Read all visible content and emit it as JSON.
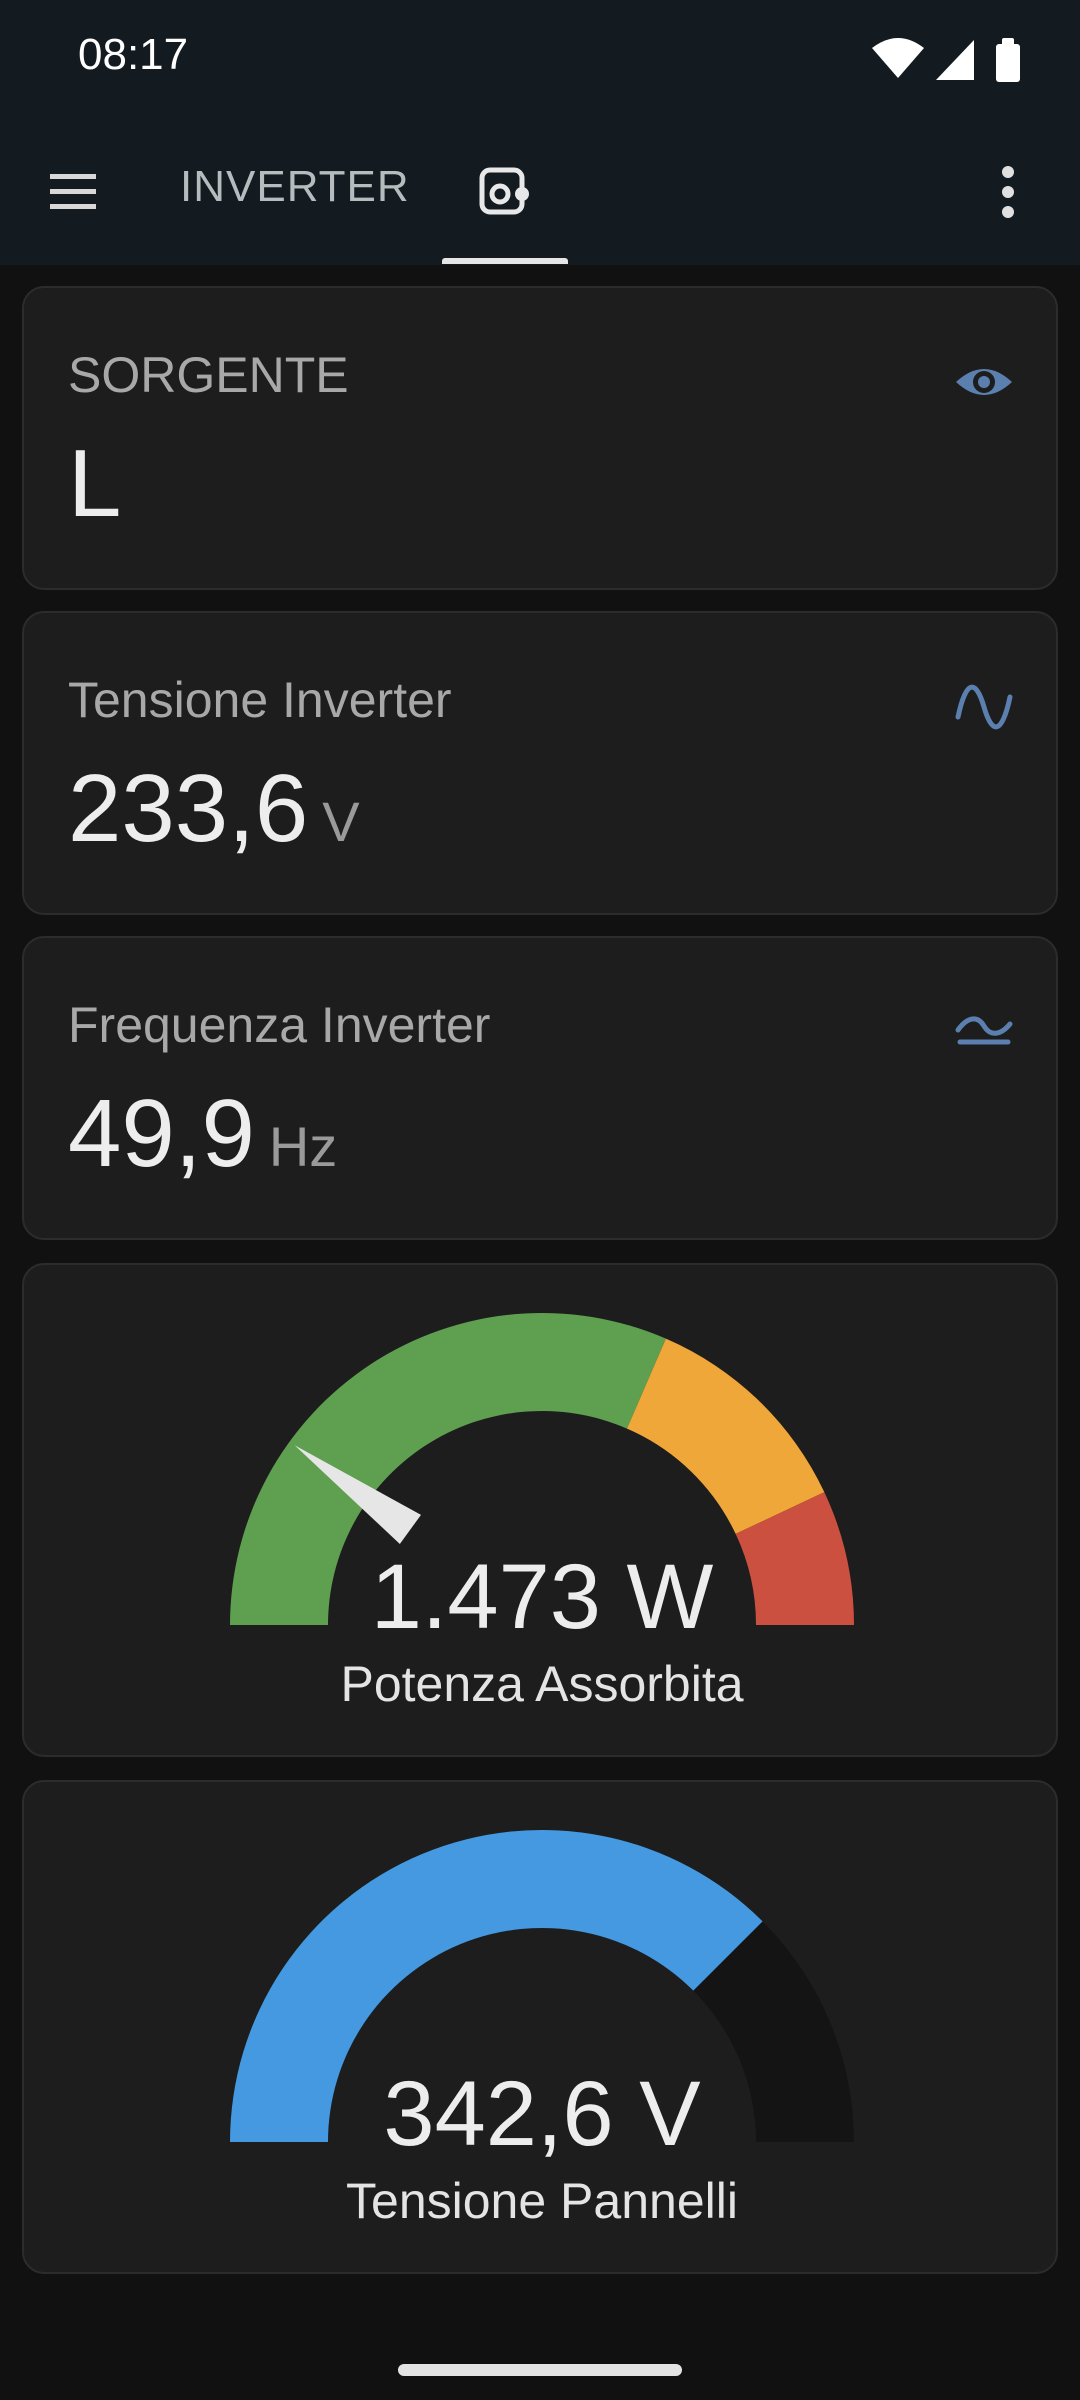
{
  "status_bar": {
    "time": "08:17"
  },
  "app_bar": {
    "title": "INVERTER"
  },
  "cards": [
    {
      "label": "SORGENTE",
      "value": "L",
      "unit": "",
      "icon": "eye-icon"
    },
    {
      "label": "Tensione Inverter",
      "value": "233,6",
      "unit": "V",
      "icon": "sine-wave-icon"
    },
    {
      "label": "Frequenza Inverter",
      "value": "49,9",
      "unit": "Hz",
      "icon": "frequency-wave-icon"
    }
  ],
  "gauges": [
    {
      "name": "Potenza Assorbita",
      "value_text": "1.473 W",
      "needle_fraction": 0.2,
      "segments": [
        {
          "from": 0.0,
          "to": 0.63,
          "color": "#5f9f50"
        },
        {
          "from": 0.63,
          "to": 0.86,
          "color": "#f0a73a"
        },
        {
          "from": 0.86,
          "to": 1.0,
          "color": "#cc5040"
        }
      ]
    },
    {
      "name": "Tensione Pannelli",
      "value_text": "342,6 V",
      "fill_fraction": 0.75,
      "fill_color": "#4499e0",
      "track_color": "#141414"
    }
  ],
  "colors": {
    "accent_icon": "#5b7fae",
    "card_bg": "#1d1d1d",
    "background": "#111111"
  }
}
